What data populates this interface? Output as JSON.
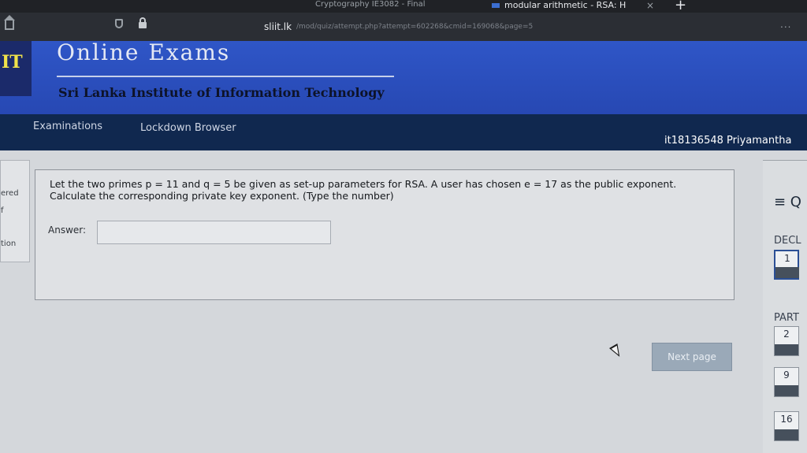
{
  "browser": {
    "tab_inactive_title": "Cryptography IE3082 - Final",
    "tab_active_title": "modular arithmetic - RSA: H",
    "tab_close": "×",
    "tab_new": "+",
    "url_host": "sliit.lk",
    "url_rest": "/mod/quiz/attempt.php?attempt=602268&cmid=169068&page=5",
    "more": "..."
  },
  "header": {
    "logo_text": "IT",
    "title": "Online Exams",
    "subtitle": "Sri Lanka Institute of Information Technology"
  },
  "nav": {
    "items": [
      "Examinations",
      "Lockdown Browser"
    ],
    "user": "it18136548 Priyamantha"
  },
  "left_panel": {
    "lines": [
      "ered",
      "f",
      "tion"
    ]
  },
  "question": {
    "text": "Let the two primes p = 11 and q = 5 be given as set-up parameters for RSA. A user has chosen e = 17 as the public exponent. Calculate the corresponding private key exponent. (Type the number)",
    "answer_label": "Answer:",
    "answer_value": ""
  },
  "next_button": "Next page",
  "quiz_nav": {
    "menu": "≡ Q",
    "section1": "DECL",
    "section2": "PART",
    "questions": [
      "1",
      "2",
      "9",
      "16"
    ]
  }
}
